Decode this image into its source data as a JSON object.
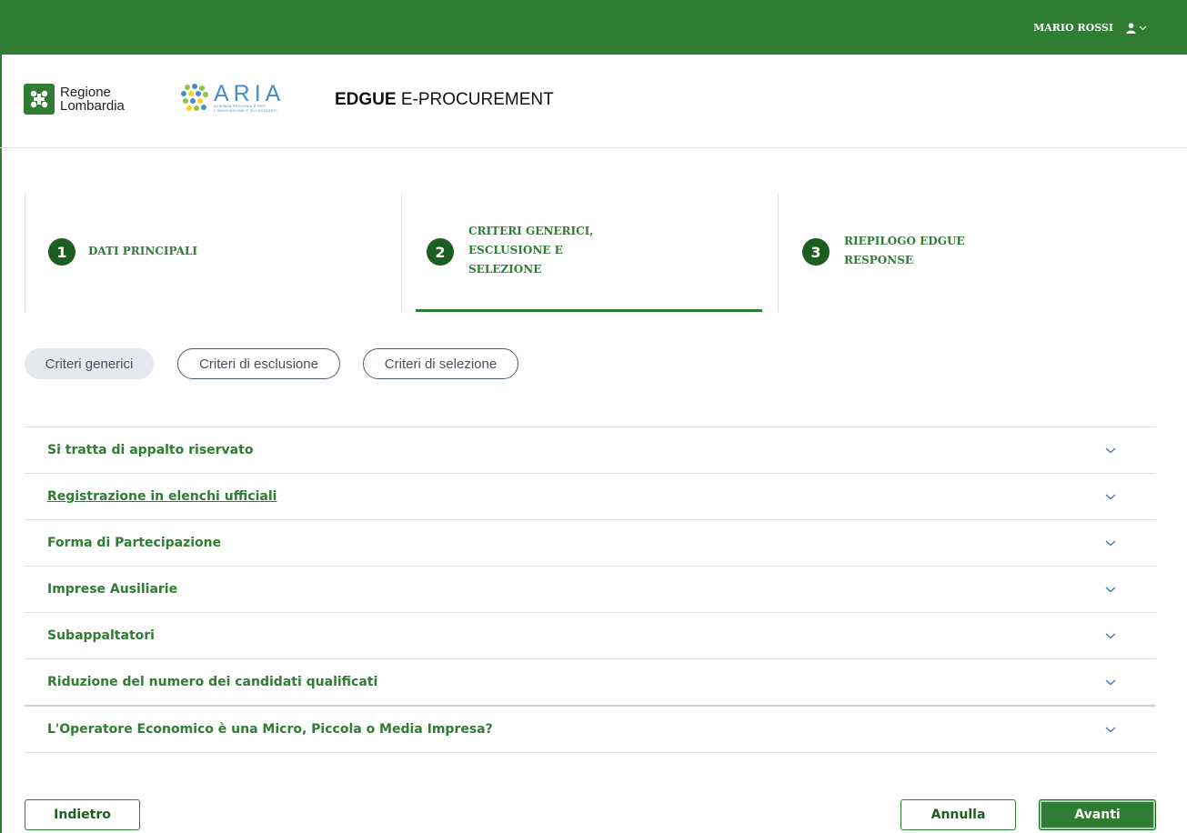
{
  "colors": {
    "brand_green": "#2e7d32",
    "dark_green": "#1b5e20",
    "aria_blue": "#4a8cc6"
  },
  "topbar": {
    "user_name": "MARIO ROSSI",
    "user_icon": "user-icon",
    "menu_icon": "chevron-down-icon"
  },
  "header": {
    "region_logo": {
      "line1": "Regione",
      "line2": "Lombardia"
    },
    "aria_logo": {
      "word": "ARIA",
      "sub1": "AZIENDA REGIONALE PER",
      "sub2": "L'INNOVAZIONE E GLI ACQUISTI"
    },
    "app_title_bold": "EDGUE",
    "app_title_rest": " E-PROCUREMENT"
  },
  "steps": [
    {
      "number": "1",
      "label": "DATI PRINCIPALI",
      "active": false
    },
    {
      "number": "2",
      "label_lines": [
        "CRITERI GENERICI,",
        "ESCLUSIONE E",
        "SELEZIONE"
      ],
      "active": true
    },
    {
      "number": "3",
      "label_lines": [
        "RIEPILOGO EDGUE",
        "RESPONSE"
      ],
      "active": false
    }
  ],
  "tabs": [
    {
      "label": "Criteri generici",
      "active": true
    },
    {
      "label": "Criteri di esclusione",
      "active": false
    },
    {
      "label": "Criteri di selezione",
      "active": false
    }
  ],
  "accordion": [
    {
      "title": "Si tratta di appalto riservato"
    },
    {
      "title": "Registrazione in elenchi ufficiali"
    },
    {
      "title": "Forma di Partecipazione"
    },
    {
      "title": "Imprese Ausiliarie"
    },
    {
      "title": "Subappaltatori"
    },
    {
      "title": "Riduzione del numero dei candidati qualificati"
    },
    {
      "title": "L'Operatore Economico è una Micro, Piccola o Media Impresa?"
    }
  ],
  "buttons": {
    "back": "Indietro",
    "cancel": "Annulla",
    "next": "Avanti"
  }
}
